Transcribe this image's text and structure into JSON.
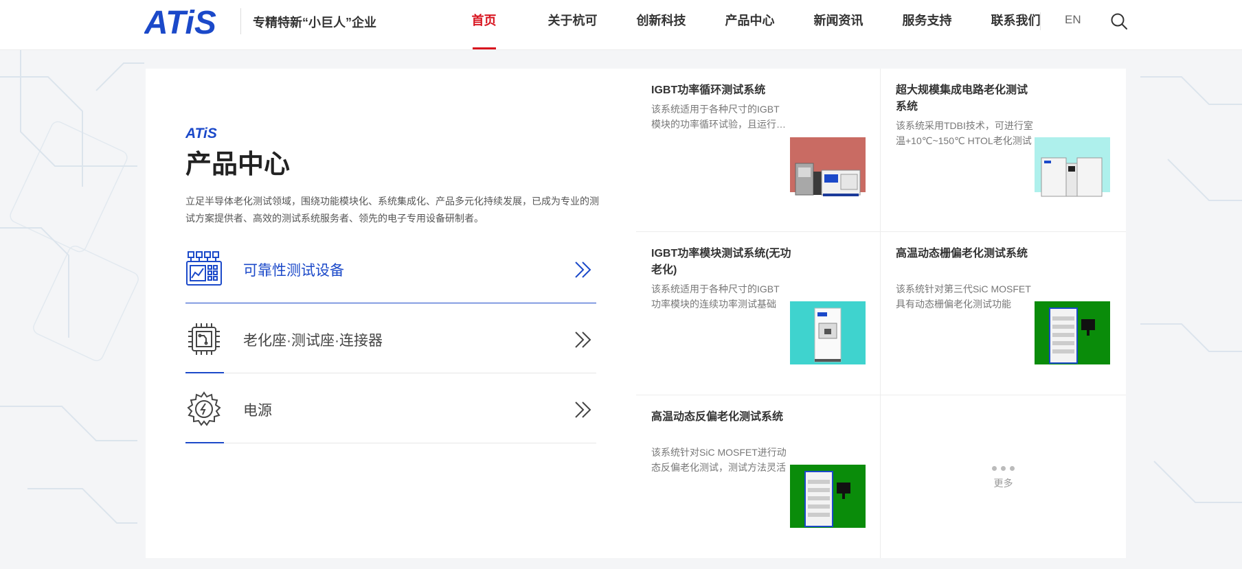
{
  "header": {
    "logo_text": "ATiS",
    "slogan": "专精特新“小巨人”企业",
    "nav": [
      {
        "label": "首页",
        "active": true
      },
      {
        "label": "关于杭可",
        "active": false
      },
      {
        "label": "创新科技",
        "active": false
      },
      {
        "label": "产品中心",
        "active": false
      },
      {
        "label": "新闻资讯",
        "active": false
      },
      {
        "label": "服务支持",
        "active": false
      },
      {
        "label": "联系我们",
        "active": false
      }
    ],
    "lang": "EN"
  },
  "products_section": {
    "mini_logo": "ATiS",
    "title": "产品中心",
    "description": "立足半导体老化测试领域，围绕功能模块化、系统集成化、产品多元化持续发展，已成为专业的测试方案提供者、高效的测试系统服务者、领先的电子专用设备研制者。",
    "categories": [
      {
        "label": "可靠性测试设备",
        "icon": "reliability-equipment-icon",
        "active": true
      },
      {
        "label": "老化座·测试座·连接器",
        "icon": "chip-socket-icon",
        "active": false
      },
      {
        "label": "电源",
        "icon": "power-gear-icon",
        "active": false
      }
    ]
  },
  "product_cards": [
    {
      "title": "IGBT功率循环测试系统",
      "description": "该系统适用于各种尺寸的IGBT模块的功率循环试验，且运行稳定可靠",
      "image_bg": "#c96b63",
      "image_type": "machine-red"
    },
    {
      "title": "超大规模集成电路老化测试系统",
      "description": "该系统采用TDBI技术，可进行室温+10℃~150℃ HTOL老化测试",
      "image_bg": "#aef0ec",
      "image_type": "cabinet-white"
    },
    {
      "title": "IGBT功率模块测试系统(无功老化)",
      "description": "该系统适用于各种尺寸的IGBT功率模块的连续功率测试基础",
      "image_bg": "#3fd3ce",
      "image_type": "machine-teal"
    },
    {
      "title": "高温动态栅偏老化测试系统",
      "description": "该系统针对第三代SiC MOSFET具有动态栅偏老化测试功能",
      "image_bg": "#0a8c0a",
      "image_type": "rack-blue"
    },
    {
      "title": "高温动态反偏老化测试系统",
      "description": "该系统针对SiC MOSFET进行动态反偏老化测试，测试方法灵活",
      "image_bg": "#0a8c0a",
      "image_type": "rack-blue"
    }
  ],
  "more": {
    "label": "更多"
  },
  "colors": {
    "accent_red": "#d8131e",
    "brand_blue": "#1b49c9"
  }
}
